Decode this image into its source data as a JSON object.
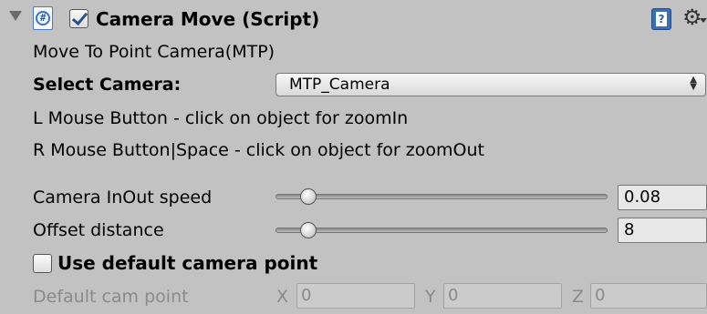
{
  "header": {
    "title": "Camera Move (Script)",
    "enabled": true,
    "script_icon": "cs-script-icon",
    "help_icon": "help-book-icon",
    "settings_icon": "gear-icon"
  },
  "info": {
    "description": "Move To Point Camera(MTP)",
    "l_mouse": "L Mouse Button - click on object for zoomIn",
    "r_mouse": "R Mouse Button|Space - click on object for zoomOut"
  },
  "select_camera": {
    "label": "Select Camera:",
    "value": "MTP_Camera"
  },
  "sliders": [
    {
      "label": "Camera InOut speed",
      "value": "0.08",
      "level": 0.1
    },
    {
      "label": "Offset distance",
      "value": "8",
      "level": 0.1
    }
  ],
  "use_default": {
    "label": "Use default camera point",
    "checked": false
  },
  "default_cam_point": {
    "label": "Default cam point",
    "x_label": "X",
    "x_value": "0",
    "y_label": "Y",
    "y_value": "0",
    "z_label": "Z",
    "z_value": "0"
  },
  "colors": {
    "background": "#c2c2c2",
    "disabled_text": "#8a8a8a",
    "check_accent": "#2d4f8e"
  }
}
